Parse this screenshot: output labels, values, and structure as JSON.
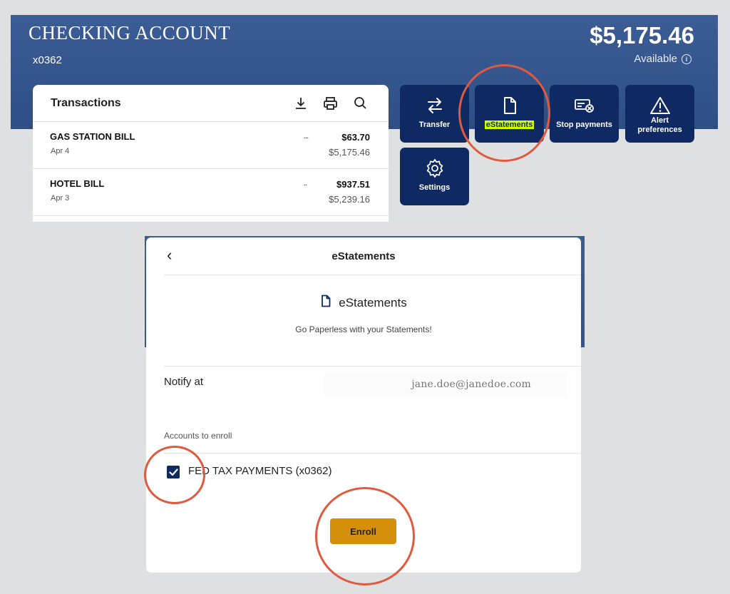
{
  "account": {
    "title": "CHECKING ACCOUNT",
    "number": "x0362",
    "balance": "$5,175.46",
    "available_label": "Available"
  },
  "transactions": {
    "title": "Transactions",
    "tools": [
      "download-icon",
      "print-icon",
      "search-icon"
    ],
    "rows": [
      {
        "name": "GAS STATION BILL",
        "date": "Apr 4",
        "dots": "...",
        "amount": "$63.70",
        "balance": "$5,175.46"
      },
      {
        "name": "HOTEL BILL",
        "date": "Apr 3",
        "dots": "..",
        "amount": "$937.51",
        "balance": "$5,239.16"
      }
    ]
  },
  "actions": [
    {
      "label": "Transfer",
      "icon": "transfer-icon"
    },
    {
      "label": "eStatements",
      "icon": "document-icon",
      "highlighted": true
    },
    {
      "label": "Stop payments",
      "icon": "stop-payment-icon"
    },
    {
      "label": "Alert preferences",
      "icon": "alert-icon"
    },
    {
      "label": "Settings",
      "icon": "gear-icon"
    }
  ],
  "estatements": {
    "header_title": "eStatements",
    "brand_name": "eStatements",
    "subtitle": "Go Paperless with your Statements!",
    "notify_label": "Notify at",
    "notify_email": "jane.doe@janedoe.com",
    "accounts_label": "Accounts to enroll",
    "account_option": "FED TAX PAYMENTS (x0362)",
    "account_checked": true,
    "enroll_label": "Enroll"
  },
  "colors": {
    "navy": "#0f2a63",
    "hero_blue": "#34548c",
    "accent_gold": "#d4900b",
    "annotation_red": "#e05a3f",
    "highlight": "#d4ff00"
  }
}
